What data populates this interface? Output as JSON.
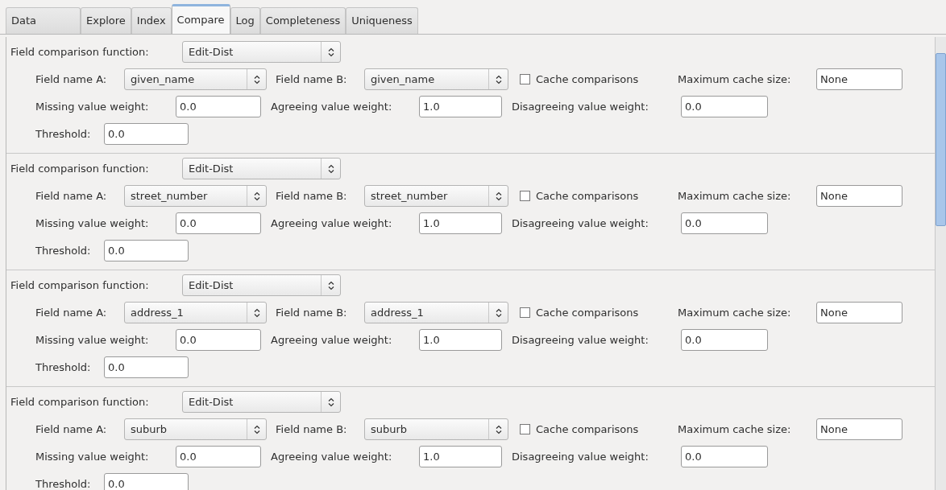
{
  "tabs": [
    {
      "label": "Data",
      "selected": false
    },
    {
      "label": "Explore",
      "selected": false
    },
    {
      "label": "Index",
      "selected": false
    },
    {
      "label": "Compare",
      "selected": true
    },
    {
      "label": "Log",
      "selected": false
    },
    {
      "label": "Completeness",
      "selected": false
    },
    {
      "label": "Uniqueness",
      "selected": false
    }
  ],
  "comparisons": [
    {
      "function_label": "Field comparison function:",
      "function": "Edit-Dist",
      "field_a_label": "Field name A:",
      "field_a": "given_name",
      "field_b_label": "Field name B:",
      "field_b": "given_name",
      "cache_label": "Cache comparisons",
      "cache_checked": false,
      "max_cache_label": "Maximum cache size:",
      "max_cache": "None",
      "missing_label": "Missing value weight:",
      "missing": "0.0",
      "agree_label": "Agreeing value weight:",
      "agree": "1.0",
      "disagree_label": "Disagreeing value weight:",
      "disagree": "0.0",
      "threshold_label": "Threshold:",
      "threshold": "0.0"
    },
    {
      "function_label": "Field comparison function:",
      "function": "Edit-Dist",
      "field_a_label": "Field name A:",
      "field_a": "street_number",
      "field_b_label": "Field name B:",
      "field_b": "street_number",
      "cache_label": "Cache comparisons",
      "cache_checked": false,
      "max_cache_label": "Maximum cache size:",
      "max_cache": "None",
      "missing_label": "Missing value weight:",
      "missing": "0.0",
      "agree_label": "Agreeing value weight:",
      "agree": "1.0",
      "disagree_label": "Disagreeing value weight:",
      "disagree": "0.0",
      "threshold_label": "Threshold:",
      "threshold": "0.0"
    },
    {
      "function_label": "Field comparison function:",
      "function": "Edit-Dist",
      "field_a_label": "Field name A:",
      "field_a": "address_1",
      "field_b_label": "Field name B:",
      "field_b": "address_1",
      "cache_label": "Cache comparisons",
      "cache_checked": false,
      "max_cache_label": "Maximum cache size:",
      "max_cache": "None",
      "missing_label": "Missing value weight:",
      "missing": "0.0",
      "agree_label": "Agreeing value weight:",
      "agree": "1.0",
      "disagree_label": "Disagreeing value weight:",
      "disagree": "0.0",
      "threshold_label": "Threshold:",
      "threshold": "0.0"
    },
    {
      "function_label": "Field comparison function:",
      "function": "Edit-Dist",
      "field_a_label": "Field name A:",
      "field_a": "suburb",
      "field_b_label": "Field name B:",
      "field_b": "suburb",
      "cache_label": "Cache comparisons",
      "cache_checked": false,
      "max_cache_label": "Maximum cache size:",
      "max_cache": "None",
      "missing_label": "Missing value weight:",
      "missing": "0.0",
      "agree_label": "Agreeing value weight:",
      "agree": "1.0",
      "disagree_label": "Disagreeing value weight:",
      "disagree": "0.0",
      "threshold_label": "Threshold:",
      "threshold": "0.0"
    }
  ]
}
